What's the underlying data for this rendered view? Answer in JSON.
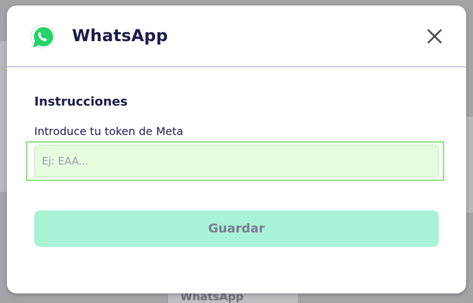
{
  "background": {
    "behind_card_title": "WhatsApp"
  },
  "modal": {
    "title": "WhatsApp",
    "logo_icon": "whatsapp-logo-icon",
    "close_icon": "close-icon"
  },
  "form": {
    "section_title": "Instrucciones",
    "token_label": "Introduce tu token de Meta",
    "token_value": "",
    "token_placeholder": "Ej: EAA...",
    "save_label": "Guardar"
  },
  "colors": {
    "title_text": "#1c1c4a",
    "whatsapp_green": "#25d366",
    "input_background": "#e6fde0",
    "focus_ring": "#8ee27e",
    "save_button_background": "#a8f2d6",
    "save_button_text": "#7b7b8f"
  }
}
